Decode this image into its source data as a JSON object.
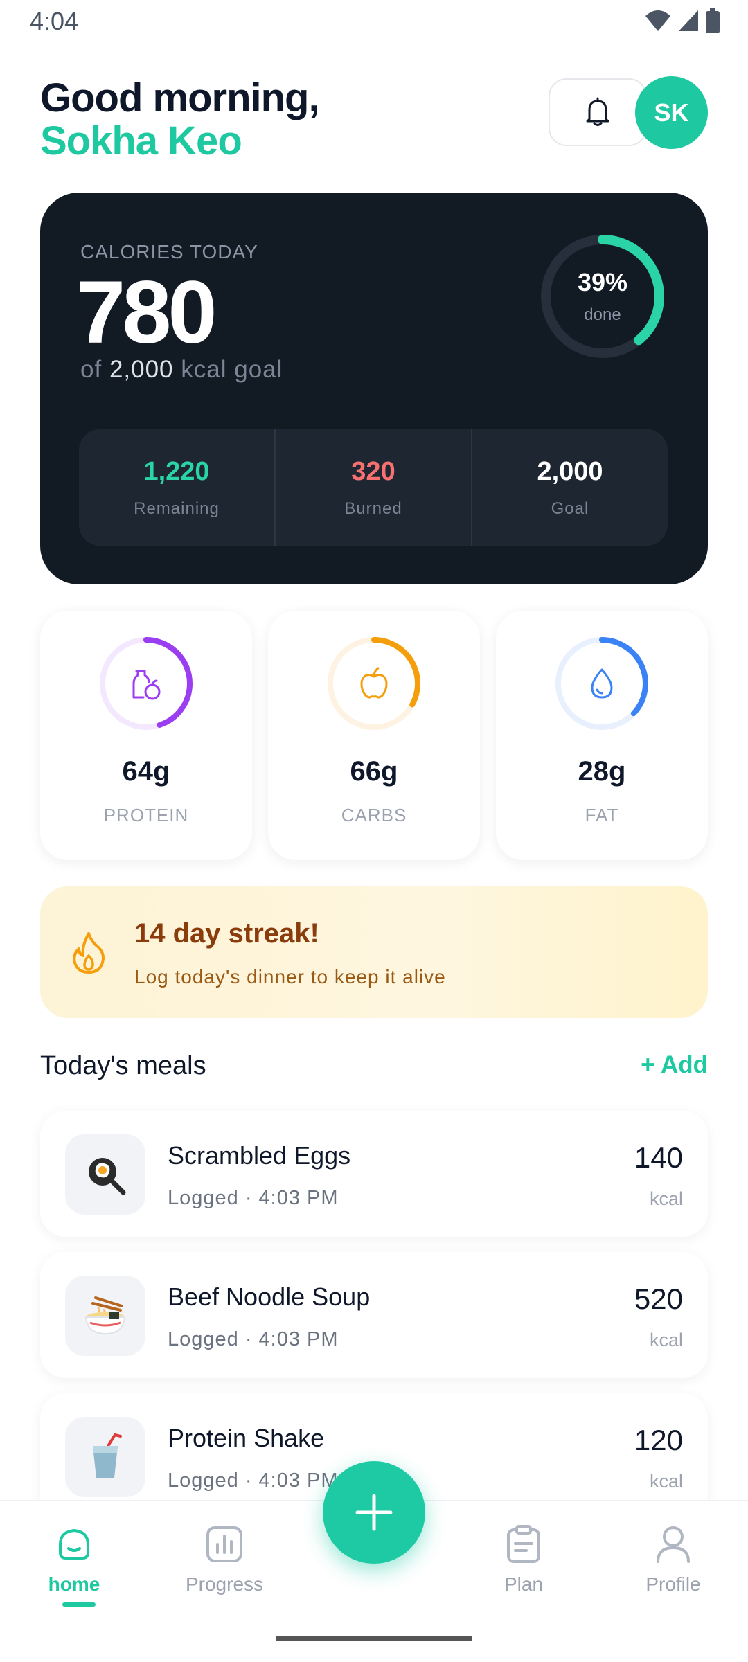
{
  "status_bar": {
    "time": "4:04"
  },
  "header": {
    "greeting": "Good morning,",
    "user_name": "Sokha Keo",
    "avatar_initials": "SK",
    "notification_icon": "bell-icon"
  },
  "calories": {
    "label": "CALORIES TODAY",
    "consumed": "780",
    "goal_prefix": "of",
    "goal_value": "2,000",
    "goal_suffix": "kcal goal",
    "progress_percent": 39,
    "progress_label": "39%",
    "progress_sub": "done",
    "stats": [
      {
        "value": "1,220",
        "label": "Remaining",
        "color": "#2bd4a6"
      },
      {
        "value": "320",
        "label": "Burned",
        "color": "#f87171"
      },
      {
        "value": "2,000",
        "label": "Goal",
        "color": "#ffffff"
      }
    ]
  },
  "macros": [
    {
      "value": "64g",
      "label": "PROTEIN",
      "icon": "bottle-apple-icon",
      "color": "#9b3df0",
      "track": "#f3e8fd",
      "fraction": 0.45
    },
    {
      "value": "66g",
      "label": "CARBS",
      "icon": "apple-icon",
      "color": "#f59e0b",
      "track": "#fef3e2",
      "fraction": 0.33
    },
    {
      "value": "28g",
      "label": "FAT",
      "icon": "droplet-icon",
      "color": "#3b82f6",
      "track": "#e8f0fe",
      "fraction": 0.37
    }
  ],
  "streak": {
    "title": "14 day streak!",
    "subtitle": "Log today's dinner to keep it alive",
    "icon": "flame-icon"
  },
  "meals_section": {
    "title": "Today's meals",
    "add_label": "+ Add"
  },
  "meals": [
    {
      "name": "Scrambled Eggs",
      "time": "Logged · 4:03 PM",
      "kcal": "140",
      "unit": "kcal",
      "emoji": "🍳"
    },
    {
      "name": "Beef Noodle Soup",
      "time": "Logged · 4:03 PM",
      "kcal": "520",
      "unit": "kcal",
      "emoji": "🍜"
    },
    {
      "name": "Protein Shake",
      "time": "Logged · 4:03 PM",
      "kcal": "120",
      "unit": "kcal",
      "emoji": "🥤"
    }
  ],
  "nav": {
    "home": "home",
    "progress": "Progress",
    "plan": "Plan",
    "profile": "Profile"
  }
}
